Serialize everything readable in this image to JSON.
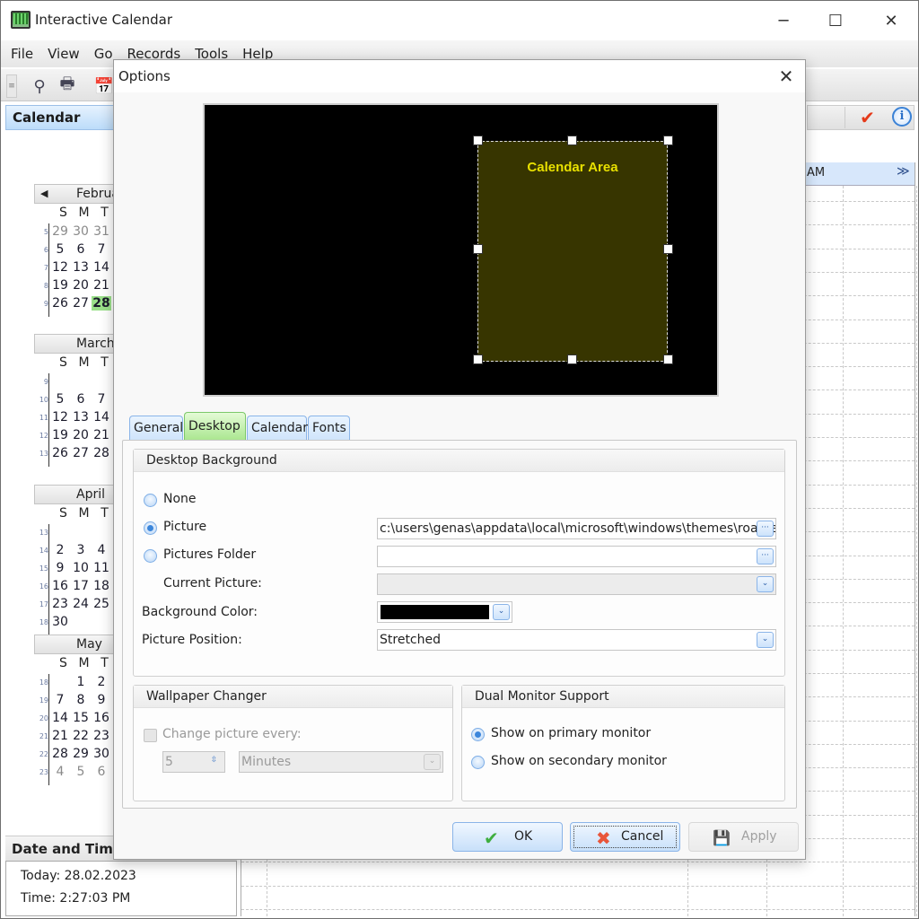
{
  "window": {
    "title": "Interactive Calendar",
    "controls": {
      "minimize": "─",
      "maximize": "☐",
      "close": "✕"
    }
  },
  "menu": [
    "File",
    "View",
    "Go",
    "Records",
    "Tools",
    "Help"
  ],
  "toolbar": {
    "icons": [
      "grip-icon",
      "search-icon",
      "print-icon",
      "calendar-icon"
    ],
    "grip": "≡",
    "search": "⚲",
    "print": "🖶",
    "calendar": "📅"
  },
  "sidebar": {
    "title": "Calendar",
    "weekday_headers": [
      "S",
      "M",
      "T"
    ],
    "months": [
      {
        "name": "February",
        "weeks": [
          {
            "wk": "5",
            "days": [
              "29",
              "30",
              "31"
            ],
            "other": [
              true,
              true,
              true
            ]
          },
          {
            "wk": "6",
            "days": [
              "5",
              "6",
              "7"
            ]
          },
          {
            "wk": "7",
            "days": [
              "12",
              "13",
              "14"
            ]
          },
          {
            "wk": "8",
            "days": [
              "19",
              "20",
              "21"
            ]
          },
          {
            "wk": "9",
            "days": [
              "26",
              "27",
              "28"
            ],
            "today_index": 2
          }
        ]
      },
      {
        "name": "March",
        "weeks": [
          {
            "wk": "9",
            "days": [
              "",
              "",
              ""
            ]
          },
          {
            "wk": "10",
            "days": [
              "5",
              "6",
              "7"
            ]
          },
          {
            "wk": "11",
            "days": [
              "12",
              "13",
              "14"
            ]
          },
          {
            "wk": "12",
            "days": [
              "19",
              "20",
              "21"
            ]
          },
          {
            "wk": "13",
            "days": [
              "26",
              "27",
              "28"
            ]
          }
        ]
      },
      {
        "name": "April",
        "weeks": [
          {
            "wk": "13",
            "days": [
              "",
              "",
              ""
            ]
          },
          {
            "wk": "14",
            "days": [
              "2",
              "3",
              "4"
            ]
          },
          {
            "wk": "15",
            "days": [
              "9",
              "10",
              "11"
            ]
          },
          {
            "wk": "16",
            "days": [
              "16",
              "17",
              "18"
            ]
          },
          {
            "wk": "17",
            "days": [
              "23",
              "24",
              "25"
            ]
          },
          {
            "wk": "18",
            "days": [
              "30",
              "",
              ""
            ]
          }
        ]
      },
      {
        "name": "May",
        "weeks": [
          {
            "wk": "18",
            "days": [
              "",
              "1",
              "2"
            ]
          },
          {
            "wk": "19",
            "days": [
              "7",
              "8",
              "9"
            ]
          },
          {
            "wk": "20",
            "days": [
              "14",
              "15",
              "16"
            ]
          },
          {
            "wk": "21",
            "days": [
              "21",
              "22",
              "23"
            ]
          },
          {
            "wk": "22",
            "days": [
              "28",
              "29",
              "30"
            ]
          },
          {
            "wk": "23",
            "days": [
              "4",
              "5",
              "6"
            ],
            "other": [
              true,
              true,
              true
            ]
          }
        ]
      }
    ],
    "prev_arrow": "◀"
  },
  "date_time": {
    "title": "Date and Time",
    "today": "Today: 28.02.2023",
    "time": "Time: 2:27:03 PM"
  },
  "schedule": {
    "header_time": "AM",
    "expand_icon": "≫",
    "confirm_icon": "✔",
    "info_icon": "i"
  },
  "dialog": {
    "title": "Options",
    "close": "✕",
    "preview_label": "Calendar Area",
    "tabs": [
      {
        "label": "General",
        "active": false
      },
      {
        "label": "Desktop",
        "active": true
      },
      {
        "label": "Calendar",
        "active": false
      },
      {
        "label": "Fonts",
        "active": false
      }
    ],
    "desktop_background": {
      "title": "Desktop Background",
      "options": [
        {
          "label": "None",
          "checked": false
        },
        {
          "label": "Picture",
          "checked": true
        },
        {
          "label": "Pictures Folder",
          "checked": false
        }
      ],
      "picture_path": "c:\\users\\genas\\appdata\\local\\microsoft\\windows\\themes\\roamed",
      "pictures_folder_value": "",
      "current_picture_label": "Current Picture:",
      "current_picture_value": "",
      "background_color_label": "Background Color:",
      "background_color": "#000000",
      "picture_position_label": "Picture Position:",
      "picture_position_value": "Stretched",
      "browse_icon": "···",
      "dropdown_icon": "⌄"
    },
    "wallpaper_changer": {
      "title": "Wallpaper Changer",
      "change_label": "Change picture every:",
      "change_checked": false,
      "interval_value": "5",
      "interval_unit": "Minutes",
      "spin_icon": "⇳"
    },
    "dual_monitor": {
      "title": "Dual Monitor Support",
      "options": [
        {
          "label": "Show on primary monitor",
          "checked": true
        },
        {
          "label": "Show on secondary monitor",
          "checked": false
        }
      ]
    },
    "buttons": {
      "ok": "OK",
      "cancel": "Cancel",
      "apply": "Apply",
      "ok_icon": "✔",
      "cancel_icon": "✖",
      "apply_icon": "💾"
    }
  },
  "colors": {
    "accent_blue": "#3b86db",
    "today_green": "#9be08a",
    "active_tab_green": "#a7e58c",
    "calendar_area_fill": "#373500",
    "calendar_area_text": "#e8e000",
    "confirm_red": "#e53a1a"
  }
}
